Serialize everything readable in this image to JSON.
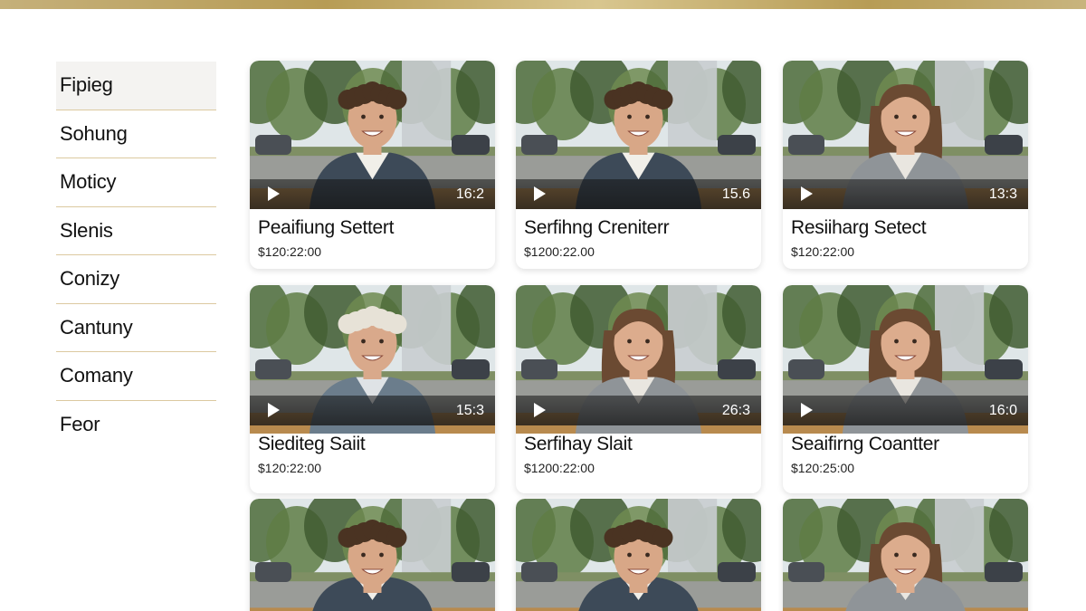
{
  "sidebar": {
    "items": [
      {
        "label": "Fipieg"
      },
      {
        "label": "Sohung"
      },
      {
        "label": "Moticy"
      },
      {
        "label": "Slenis"
      },
      {
        "label": "Conizy"
      },
      {
        "label": "Cantuny"
      },
      {
        "label": "Comany"
      },
      {
        "label": "Feor"
      }
    ]
  },
  "videos": [
    {
      "title": "Peaifiung Settert",
      "price": "$120:22:00",
      "duration": "16:2",
      "person": "man-curly"
    },
    {
      "title": "Serfihng Creniterr",
      "price": "$1200:22.00",
      "duration": "15.6",
      "person": "man-curly"
    },
    {
      "title": "Resiiharg Setect",
      "price": "$120:22:00",
      "duration": "13:3",
      "person": "woman-long-hair"
    },
    {
      "title": "Siediteg Saiit",
      "price": "$120:22:00",
      "duration": "15:3",
      "person": "older-woman-white-hair"
    },
    {
      "title": "Serfihay Slait",
      "price": "$1200:22:00",
      "duration": "26:3",
      "person": "woman-long-hair"
    },
    {
      "title": "Seaifirng Coantter",
      "price": "$120:25:00",
      "duration": "16:0",
      "person": "woman-long-hair"
    },
    {
      "title": "",
      "price": "",
      "duration": "",
      "person": "man-curly"
    },
    {
      "title": "",
      "price": "",
      "duration": "",
      "person": "man-curly"
    },
    {
      "title": "",
      "price": "",
      "duration": "",
      "person": "woman-long-hair"
    }
  ],
  "colors": {
    "accent_gold": "#c5b07a",
    "divider": "#dcc9a0",
    "active_bg": "#f4f3f1"
  },
  "icons": {
    "play": "play-icon"
  }
}
